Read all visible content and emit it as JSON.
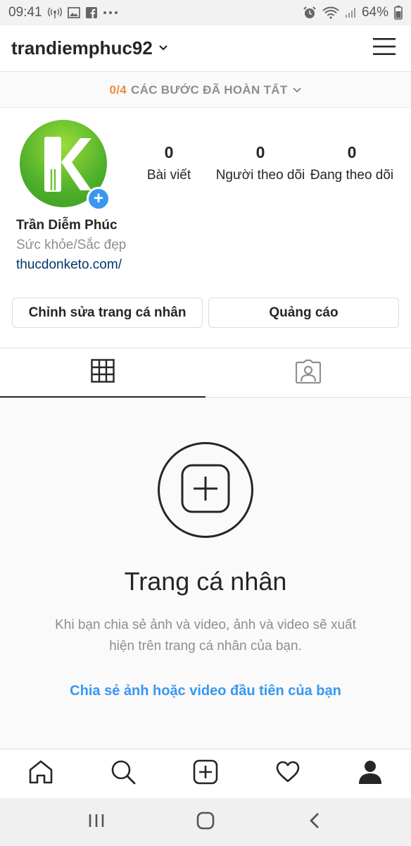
{
  "status_bar": {
    "time": "09:41",
    "battery": "64%",
    "left_icons": [
      "signal-broadcast-icon",
      "image-icon",
      "facebook-icon",
      "more-dots-icon"
    ],
    "right_icons": [
      "alarm-icon",
      "wifi-icon",
      "cell-signal-icon"
    ]
  },
  "header": {
    "username": "trandiemphuc92",
    "menu_icon": "hamburger-icon"
  },
  "steps_banner": {
    "count": "0/4",
    "label": "CÁC BƯỚC ĐÃ HOÀN TẤT"
  },
  "profile": {
    "full_name": "Trần Diễm Phúc",
    "category": "Sức khỏe/Sắc đẹp",
    "website": "thucdonketo.com/",
    "avatar_letter": "k",
    "stats": [
      {
        "value": "0",
        "label": "Bài viết"
      },
      {
        "value": "0",
        "label": "Người theo dõi"
      },
      {
        "value": "0",
        "label": "Đang theo dõi"
      }
    ],
    "edit_button": "Chỉnh sửa trang cá nhân",
    "ads_button": "Quảng cáo"
  },
  "tabs": [
    {
      "icon": "grid-icon",
      "active": true
    },
    {
      "icon": "tagged-portrait-icon",
      "active": false
    }
  ],
  "empty_state": {
    "title": "Trang cá nhân",
    "description": "Khi bạn chia sẻ ảnh và video, ảnh và video sẽ xuất hiện trên trang cá nhân của bạn.",
    "cta": "Chia sẻ ảnh hoặc video đầu tiên của bạn"
  },
  "bottom_nav": [
    "home-icon",
    "search-icon",
    "add-post-icon",
    "heart-icon",
    "profile-icon"
  ],
  "system_nav": [
    "recent-apps-icon",
    "home-button-icon",
    "back-icon"
  ],
  "colors": {
    "accent_blue": "#3897f0",
    "steps_orange": "#f08b3a",
    "link_dark_blue": "#003569",
    "avatar_green": "#4fb02a"
  }
}
